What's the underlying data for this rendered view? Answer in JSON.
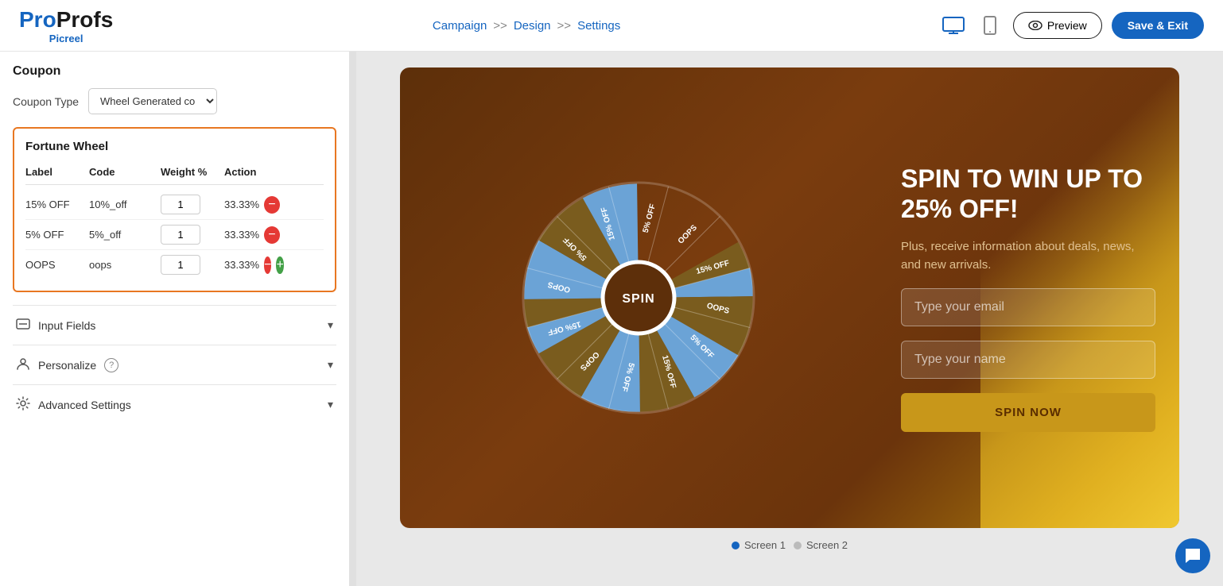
{
  "header": {
    "logo_pro": "Pro",
    "logo_profs": "Profs",
    "logo_sub": "Picreel",
    "nav": {
      "campaign": "Campaign",
      "arrow1": ">>",
      "design": "Design",
      "arrow2": ">>",
      "settings": "Settings"
    },
    "preview_label": "Preview",
    "save_label": "Save & Exit"
  },
  "sidebar": {
    "coupon_title": "Coupon",
    "coupon_type_label": "Coupon Type",
    "coupon_type_value": "Wheel Generated co",
    "fortune_wheel_title": "Fortune Wheel",
    "table_headers": {
      "label": "Label",
      "code": "Code",
      "weight": "Weight %",
      "action": "Action"
    },
    "wheel_rows": [
      {
        "label": "15% OFF",
        "code": "10%_off",
        "weight": "1",
        "percent": "33.33%"
      },
      {
        "label": "5% OFF",
        "code": "5%_off",
        "weight": "1",
        "percent": "33.33%"
      },
      {
        "label": "OOPS",
        "code": "oops",
        "weight": "1",
        "percent": "33.33%"
      }
    ],
    "input_fields_label": "Input Fields",
    "personalize_label": "Personalize",
    "advanced_settings_label": "Advanced Settings"
  },
  "popup": {
    "spin_headline": "SPIN TO WIN UP TO 25% OFF!",
    "spin_sub": "Plus, receive information about deals, news, and new arrivals.",
    "email_placeholder": "Type your email",
    "name_placeholder": "Type your name",
    "spin_now_label": "SPIN NOW",
    "spin_button": "SPIN",
    "screen1_label": "Screen 1",
    "screen2_label": "Screen 2",
    "wheel_segments": [
      {
        "label": "15% OFF",
        "color": "#7a5c1e"
      },
      {
        "label": "OOPS",
        "color": "#6ba3d6"
      },
      {
        "label": "5% OFF",
        "color": "#7a5c1e"
      },
      {
        "label": "15% OFF",
        "color": "#6ba3d6"
      },
      {
        "label": "5% OFF",
        "color": "#7a5c1e"
      },
      {
        "label": "OOPS",
        "color": "#6ba3d6"
      },
      {
        "label": "15% OFF",
        "color": "#7a5c1e"
      },
      {
        "label": "OOPS",
        "color": "#6ba3d6"
      },
      {
        "label": "5% OFF",
        "color": "#7a5c1e"
      },
      {
        "label": "15% OFF",
        "color": "#6ba3d6"
      },
      {
        "label": "5% OFF",
        "color": "#7a5c1e"
      },
      {
        "label": "OOPS",
        "color": "#6ba3d6"
      }
    ]
  }
}
